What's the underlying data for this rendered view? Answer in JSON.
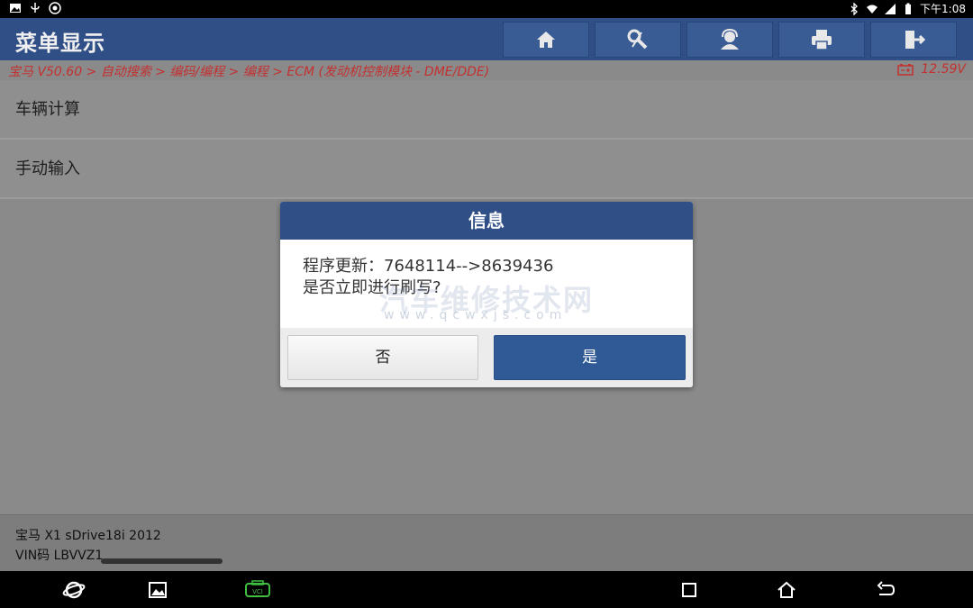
{
  "status_bar": {
    "time": "下午1:08",
    "left_icons": [
      "image-icon",
      "usb-icon",
      "settings-icon"
    ],
    "right_icons": [
      "bluetooth-icon",
      "wifi-icon",
      "signal-icon",
      "battery-icon"
    ]
  },
  "header": {
    "title": "菜单显示",
    "toolbar": [
      "home-icon",
      "diagnose-icon",
      "user-icon",
      "print-icon",
      "exit-icon"
    ]
  },
  "breadcrumb": {
    "path": "宝马 V50.60 > 自动搜索 > 编码/编程 > 编程 > ECM (发动机控制模块 - DME/DDE)",
    "voltage": "12.59V"
  },
  "list": {
    "items": [
      {
        "label": "车辆计算"
      },
      {
        "label": "手动输入"
      }
    ]
  },
  "dialog": {
    "title": "信息",
    "message_line1": "程序更新：7648114-->8639436",
    "message_line2": "是否立即进行刷写?",
    "watermark": "汽车维修技术网",
    "watermark_url": "www.qcwxjs.com",
    "no_label": "否",
    "yes_label": "是"
  },
  "vehicle": {
    "model": "宝马 X1 sDrive18i 2012",
    "vin": "VIN码 LBVVZ1"
  },
  "colors": {
    "header_bg": "#2f4f86",
    "accent_red": "#c43030",
    "yes_button": "#2f5a96"
  }
}
